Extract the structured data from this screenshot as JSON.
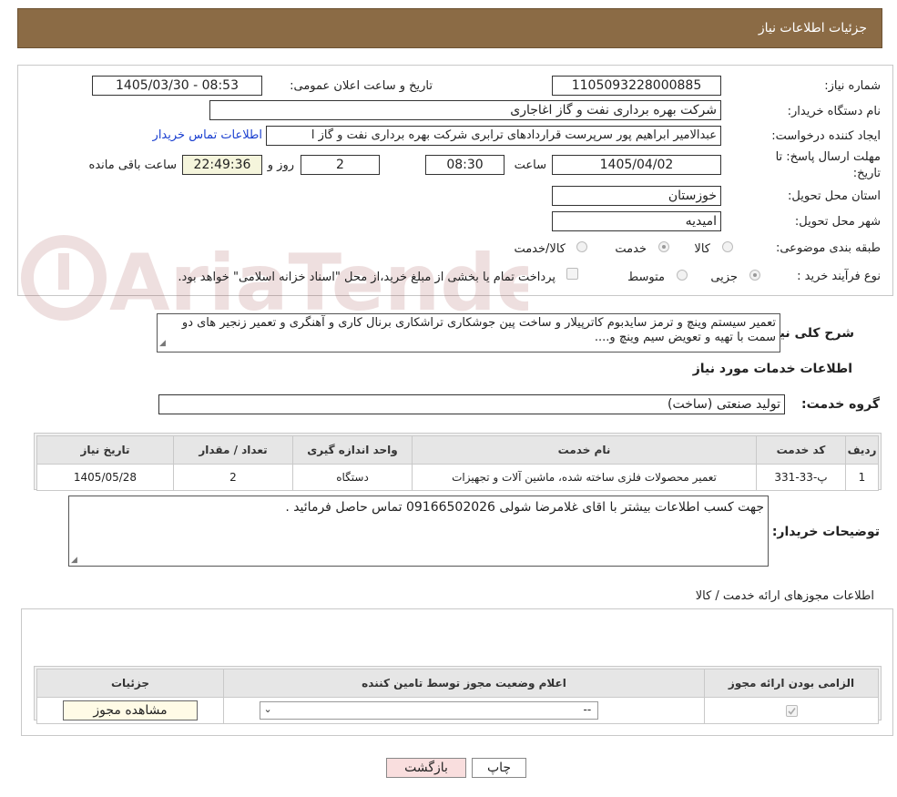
{
  "header": {
    "title": "جزئیات اطلاعات نیاز"
  },
  "form": {
    "need_number_label": "شماره نیاز:",
    "need_number": "1105093228000885",
    "announce_label": "تاریخ و ساعت اعلان عمومی:",
    "announce_value": "1405/03/30 - 08:53",
    "buyer_org_label": "نام دستگاه خریدار:",
    "buyer_org": "شرکت بهره برداری نفت و گاز اغاجاری",
    "creator_label": "ایجاد کننده درخواست:",
    "creator": "عبدالامیر ابراهیم پور سرپرست قراردادهای ترابری شرکت بهره برداری نفت و گاز ا",
    "contact_link": "اطلاعات تماس خریدار",
    "deadline_label_1": "مهلت ارسال پاسخ: تا",
    "deadline_label_2": "تاریخ:",
    "deadline_date": "1405/04/02",
    "time_label": "ساعت",
    "deadline_time": "08:30",
    "days_value": "2",
    "days_label": "روز و",
    "remaining_time": "22:49:36",
    "remaining_label": "ساعت باقی مانده",
    "province_label": "استان محل تحویل:",
    "province": "خوزستان",
    "city_label": "شهر محل تحویل:",
    "city": "امیدیه",
    "category_label": "طبقه بندی موضوعی:",
    "category_options": [
      "کالا",
      "خدمت",
      "کالا/خدمت"
    ],
    "category_selected": "خدمت",
    "purchase_type_label": "نوع فرآیند خرید :",
    "purchase_options": [
      "جزیی",
      "متوسط"
    ],
    "purchase_selected": "جزیی",
    "payment_note": "پرداخت تمام یا بخشی از مبلغ خرید،از محل \"اسناد خزانه اسلامی\" خواهد بود."
  },
  "description": {
    "label": "شرح کلی نیاز:",
    "text": "تعمیر سیستم وینچ و ترمز سایدبوم کاترپیلار و ساخت پین جوشکاری تراشکاری برنال کاری و آهنگری و تعمیر زنجیر های دو سمت با تهیه و تعویض سیم وینچ و...."
  },
  "services": {
    "title": "اطلاعات خدمات مورد نیاز",
    "group_label": "گروه خدمت:",
    "group_value": "تولید صنعتی (ساخت)",
    "table": {
      "headers": [
        "ردیف",
        "کد خدمت",
        "نام خدمت",
        "واحد اندازه گیری",
        "تعداد / مقدار",
        "تاریخ نیاز"
      ],
      "rows": [
        [
          "1",
          "پ-33-331",
          "تعمیر محصولات فلزی ساخته شده، ماشین آلات و تجهیزات",
          "دستگاه",
          "2",
          "1405/05/28"
        ]
      ]
    }
  },
  "buyer_notes": {
    "label": "توضیحات خریدار:",
    "text": "جهت کسب اطلاعات بیشتر با اقای غلامرضا شولی  09166502026  تماس حاصل فرمائید ."
  },
  "licenses": {
    "title": "اطلاعات مجوزهای ارائه خدمت / کالا",
    "headers": [
      "الزامی بودن ارائه مجوز",
      "اعلام وضعیت مجوز توسط تامین کننده",
      "جزئیات"
    ],
    "select_value": "--",
    "view_button": "مشاهده مجوز"
  },
  "actions": {
    "print": "چاپ",
    "back": "بازگشت"
  },
  "colors": {
    "header_bg": "#8b6b45",
    "link": "#1a3fd0",
    "back_btn": "#f9dede"
  }
}
